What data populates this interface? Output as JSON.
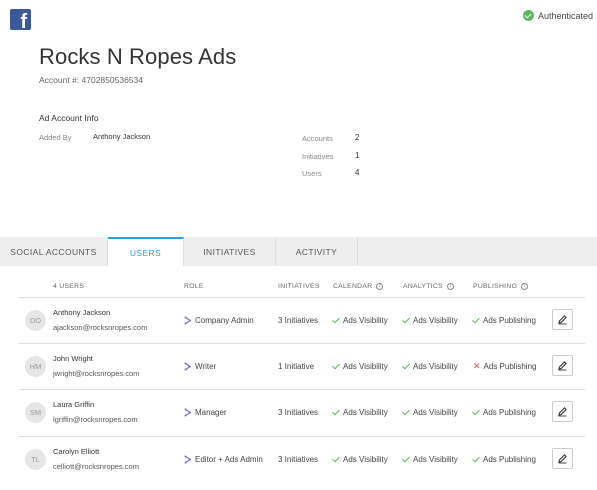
{
  "header": {
    "brand_icon": "facebook-icon",
    "auth_status": "Authenticated",
    "title": "Rocks N Ropes Ads",
    "account_number": "Account #: 4702850536534"
  },
  "info": {
    "section_title": "Ad Account Info",
    "added_by_label": "Added By",
    "added_by_value": "Anthony Jackson",
    "stats": [
      {
        "label": "Accounts",
        "value": "2"
      },
      {
        "label": "Initiatives",
        "value": "1"
      },
      {
        "label": "Users",
        "value": "4"
      }
    ]
  },
  "tabs": [
    {
      "label": "SOCIAL ACCOUNTS",
      "active": false
    },
    {
      "label": "USERS",
      "active": true
    },
    {
      "label": "INITIATIVES",
      "active": false
    },
    {
      "label": "ACTIVITY",
      "active": false
    }
  ],
  "table": {
    "headers": {
      "users": "4 USERS",
      "role": "ROLE",
      "initiatives": "INITIATIVES",
      "calendar": "CALENDAR",
      "analytics": "ANALYTICS",
      "publishing": "PUBLISHING"
    },
    "rows": [
      {
        "initials": "DO",
        "name": "Anthony Jackson",
        "email": "ajackson@rocksnropes.com",
        "role": "Company Admin",
        "initiatives": "3 Initiatives",
        "calendar": "Ads Visibility",
        "calendar_ok": true,
        "analytics": "Ads Visibility",
        "analytics_ok": true,
        "publishing": "Ads Publishing",
        "publishing_ok": true
      },
      {
        "initials": "HM",
        "name": "John Wright",
        "email": "jwright@rocksnropes.com",
        "role": "Writer",
        "initiatives": "1 Initiative",
        "calendar": "Ads Visibility",
        "calendar_ok": true,
        "analytics": "Ads Visibility",
        "analytics_ok": true,
        "publishing": "Ads Publishing",
        "publishing_ok": false
      },
      {
        "initials": "SM",
        "name": "Laura Griffin",
        "email": "lgriffin@rocksnropes.com",
        "role": "Manager",
        "initiatives": "3 Initiatives",
        "calendar": "Ads Visibility",
        "calendar_ok": true,
        "analytics": "Ads Visibility",
        "analytics_ok": true,
        "publishing": "Ads Publishing",
        "publishing_ok": true
      },
      {
        "initials": "TL",
        "name": "Carolyn Elliott",
        "email": "celliott@rocksnropes.com",
        "role": "Editor + Ads Admin",
        "initiatives": "3 Initiatives",
        "calendar": "Ads Visibility",
        "calendar_ok": true,
        "analytics": "Ads Visibility",
        "analytics_ok": true,
        "publishing": "Ads Publishing",
        "publishing_ok": true
      }
    ]
  },
  "colors": {
    "accent": "#2aa3d6",
    "facebook": "#3b5998",
    "success": "#5cb85c",
    "error": "#d9534f"
  }
}
